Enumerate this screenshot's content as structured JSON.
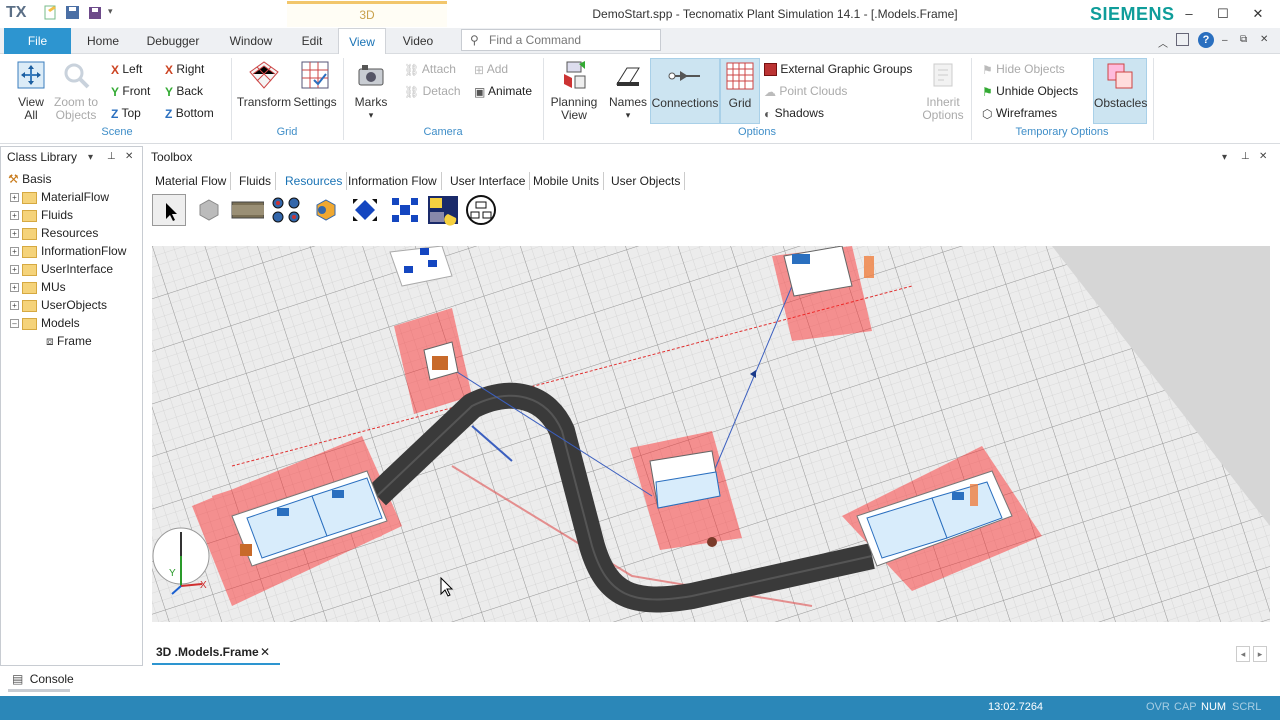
{
  "titlebar": {
    "app_logo": "TX",
    "context_tab": "3D",
    "window_title": "DemoStart.spp - Tecnomatix Plant Simulation 14.1 - [.Models.Frame]",
    "brand": "SIEMENS"
  },
  "menu": {
    "file": "File",
    "home": "Home",
    "debugger": "Debugger",
    "window": "Window",
    "edit": "Edit",
    "view": "View",
    "video": "Video",
    "find_placeholder": "Find a Command"
  },
  "ribbon": {
    "scene": {
      "group": "Scene",
      "view_all": "View All",
      "zoom_to_objects": "Zoom to Objects",
      "left": "Left",
      "right": "Right",
      "front": "Front",
      "back": "Back",
      "top": "Top",
      "bottom": "Bottom"
    },
    "grid": {
      "group": "Grid",
      "transform": "Transform",
      "settings": "Settings"
    },
    "camera": {
      "group": "Camera",
      "marks": "Marks",
      "attach": "Attach",
      "detach": "Detach",
      "add": "Add",
      "animate": "Animate"
    },
    "options": {
      "group": "Options",
      "planning_view": "Planning View",
      "names": "Names",
      "connections": "Connections",
      "grid": "Grid",
      "external_graphic_groups": "External Graphic Groups",
      "point_clouds": "Point Clouds",
      "shadows": "Shadows",
      "inherit_options": "Inherit Options"
    },
    "temporary": {
      "group": "Temporary Options",
      "hide_objects": "Hide Objects",
      "unhide_objects": "Unhide Objects",
      "wireframes": "Wireframes",
      "obstacles": "Obstacles"
    }
  },
  "class_library": {
    "title": "Class Library",
    "items": [
      "Basis",
      "MaterialFlow",
      "Fluids",
      "Resources",
      "InformationFlow",
      "UserInterface",
      "MUs",
      "UserObjects",
      "Models",
      "Frame"
    ]
  },
  "toolbox": {
    "title": "Toolbox",
    "tabs": [
      "Material Flow",
      "Fluids",
      "Resources",
      "Information Flow",
      "User Interface",
      "Mobile Units",
      "User Objects"
    ]
  },
  "document_tab": {
    "label": "3D .Models.Frame"
  },
  "console": {
    "label": "Console"
  },
  "status": {
    "time": "13:02.7264",
    "ovr": "OVR",
    "cap": "CAP",
    "num": "NUM",
    "scrl": "SCRL"
  },
  "colors": {
    "accent": "#2d95d0",
    "brand": "#0f9d9a",
    "status": "#2b87b8",
    "floor": "#d9d9d9",
    "highlight": "#ff2020"
  }
}
